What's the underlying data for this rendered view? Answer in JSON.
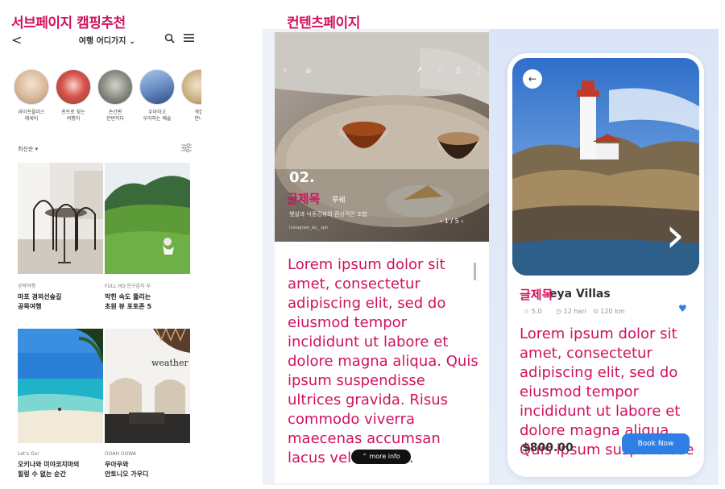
{
  "left": {
    "section_title": "서브페이지 캠핑추천",
    "topbar": {
      "back": "<",
      "title": "여행 어디가지",
      "title_chevron": "⌄",
      "search_icon": "search-icon",
      "menu_icon": "menu-icon"
    },
    "stories": [
      {
        "label": "라이프플러스\n에세이"
      },
      {
        "label": "친트로 찾는\n여행지"
      },
      {
        "label": "손간판\n한번하다"
      },
      {
        "label": "우아하고\n우아하는 예술"
      },
      {
        "label": "색깔\n만나"
      }
    ],
    "sort_label": "최신순",
    "sort_chevron": "▾",
    "filter_icon": "sliders-icon",
    "cards": [
      {
        "category": "공략여행",
        "title": "마포 경의선숲길\n공목여행"
      },
      {
        "category": "FULL HD 인구감자 부",
        "title": "막힌 속도 뚫리는\n초원 뷰 포토존 5"
      },
      {
        "category": "Let's Go!",
        "title": "오키나와 미야코지마의\n힐링 수 없는 순간"
      },
      {
        "category": "OOAH OOWA",
        "title": "우아우와\n안토니오 가우디"
      }
    ],
    "weather_text": "weather"
  },
  "middle": {
    "section_title": "컨텐츠페이지",
    "photo_number": "02.",
    "photo_title": "글제목",
    "photo_subtitle": "루쉐",
    "photo_desc": "햇살과 낙동강뷰의 환상적인 조합",
    "photo_caption": "Instagram_do__sph",
    "page_indicator": "‹  1 / 5  ›",
    "lorem": "Lorem ipsum dolor sit amet, consectetur adipiscing elit, sed do eiusmod tempor incididunt ut labore et dolore magna aliqua. Quis ipsum suspendisse ultrices gravida. Risus commodo viverra maecenas accumsan lacus vel facilisis.",
    "more_button": "⌃ more info"
  },
  "right": {
    "villa_name": "eya Villas",
    "title": "글제목",
    "rating": "☆ 5.0",
    "duration": "◷ 12 hari",
    "distance": "⊙ 120 km",
    "lorem": "Lorem ipsum dolor sit amet, consectetur adipiscing elit, sed do eiusmod tempor incididunt ut labore et dolore magna aliqua. Quis ipsum suspendisse",
    "price": "$800.00",
    "book_button": "Book Now"
  }
}
